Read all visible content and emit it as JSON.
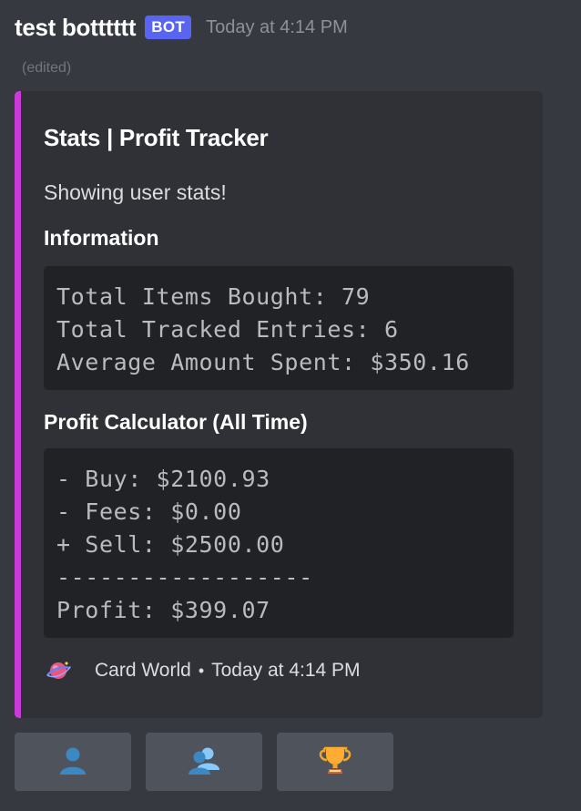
{
  "message": {
    "author": "test botttttt",
    "badge": "BOT",
    "timestamp": "Today at 4:14 PM",
    "edited_label": "(edited)"
  },
  "embed": {
    "accent_color": "#c93ad6",
    "title": "Stats | Profit Tracker",
    "description": "Showing user stats!",
    "fields": [
      {
        "name": "Information",
        "lines": [
          "Total Items Bought: 79",
          "Total Tracked Entries: 6",
          "Average Amount Spent: $350.16"
        ]
      },
      {
        "name": "Profit Calculator (All Time)",
        "lines": [
          "- Buy: $2100.93",
          "- Fees: $0.00",
          "+ Sell: $2500.00",
          "------------------",
          "Profit: $399.07"
        ]
      }
    ],
    "footer": {
      "icon": "card-world-planet-icon",
      "text": "Card World",
      "separator": "•",
      "timestamp": "Today at 4:14 PM"
    }
  },
  "buttons": [
    {
      "icon": "user-icon"
    },
    {
      "icon": "users-icon"
    },
    {
      "icon": "trophy-icon"
    }
  ]
}
